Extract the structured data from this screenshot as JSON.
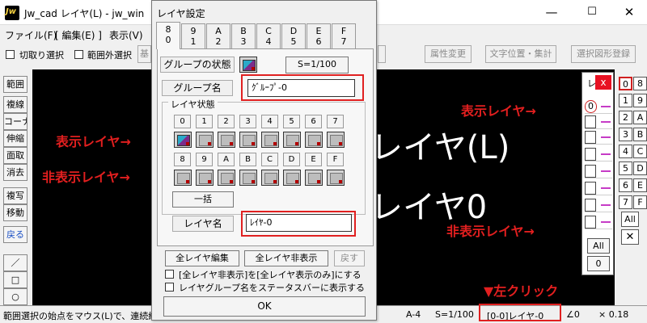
{
  "window": {
    "title": "Jw_cad レイヤ(L) - jw_win",
    "minimize": "—",
    "maximize": "☐",
    "close": "✕"
  },
  "menubar": [
    "ファイル(F)",
    "[ 編集(E) ]",
    "表示(V)"
  ],
  "options": {
    "crop_select": "切取り選択",
    "outside_select": "範囲外選択",
    "base_btn_partial": "基",
    "attr_change": "属性変更",
    "text_pos": "文字位置・集計",
    "select_register": "選択図形登録"
  },
  "left_tools": [
    "範囲",
    "複線",
    "コーナー",
    "伸縮",
    "面取",
    "消去",
    "複写",
    "移動",
    "戻る",
    "／",
    "□",
    "○",
    "◇"
  ],
  "canvas": {
    "text_large_1": "レイヤ(L)",
    "text_large_2": "レイヤ0"
  },
  "status": {
    "message": "範囲選択の始点をマウス(L)で、連続線",
    "paper": "A-4",
    "scale": "S=1/100",
    "layer": "[0-0]レイヤ-0",
    "angle": "∠0",
    "factor": "× 0.18"
  },
  "dialog": {
    "title": "レイヤ設定",
    "tabs": [
      {
        "top": "8",
        "bottom": "0"
      },
      {
        "top": "9",
        "bottom": "1"
      },
      {
        "top": "A",
        "bottom": "2"
      },
      {
        "top": "B",
        "bottom": "3"
      },
      {
        "top": "C",
        "bottom": "4"
      },
      {
        "top": "D",
        "bottom": "5"
      },
      {
        "top": "E",
        "bottom": "6"
      },
      {
        "top": "F",
        "bottom": "7"
      }
    ],
    "group_state_label": "グループの状態",
    "scale_button": "S=1/100",
    "group_name_label": "グループ名",
    "group_name_value": "ｸﾞﾙｰﾌﾟ-0",
    "layer_state_label": "レイヤ状態",
    "layer_row1": [
      "0",
      "1",
      "2",
      "3",
      "4",
      "5",
      "6",
      "7"
    ],
    "layer_row2": [
      "8",
      "9",
      "A",
      "B",
      "C",
      "D",
      "E",
      "F"
    ],
    "bulk_button": "一括",
    "layer_name_label": "レイヤ名",
    "layer_name_value": "ﾚｲﾔ-0",
    "all_edit": "全レイヤ編集",
    "all_hide": "全レイヤ非表示",
    "revert": "戻す",
    "check1": "[全レイヤ非表示]を[全レイヤ表示のみ]にする",
    "check2": "レイヤグループ名をステータスバーに表示する",
    "ok": "OK"
  },
  "layer_buttons": [
    "0",
    "8",
    "1",
    "9",
    "2",
    "A",
    "3",
    "B",
    "4",
    "C",
    "5",
    "D",
    "6",
    "E",
    "7",
    "F"
  ],
  "layer_all": "All",
  "layer_x": "✕",
  "float_panel": {
    "title": "レ",
    "close": "x",
    "first_cell": "0",
    "all": "All",
    "zero": "0"
  },
  "annotations": {
    "visible_layer_left": "表示レイヤ→",
    "hidden_layer_left": "非表示レイヤ→",
    "visible_layer_right": "表示レイヤ→",
    "hidden_layer_right": "非表示レイヤ→",
    "left_click": "▼左クリック"
  },
  "colors": {
    "annotation": "#e21f1f",
    "canvas": "#000000",
    "layer_marker": "#c63cc6"
  }
}
